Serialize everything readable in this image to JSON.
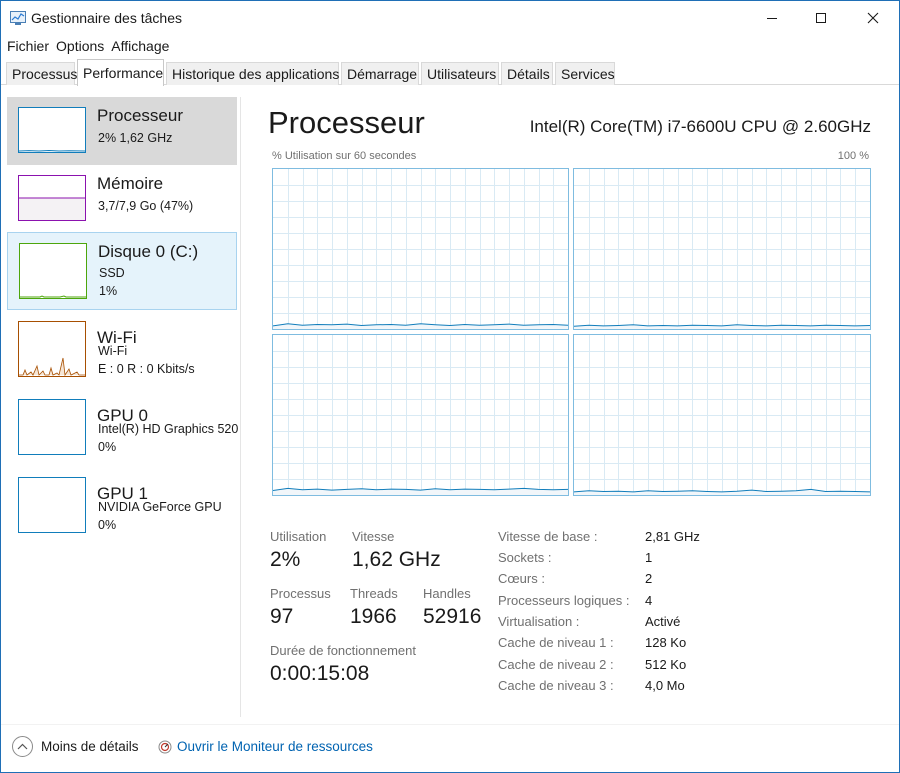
{
  "window": {
    "title": "Gestionnaire des tâches",
    "accent": "#1f6fb6"
  },
  "menu": [
    "Fichier",
    "Options",
    "Affichage"
  ],
  "tabs": [
    {
      "label": "Processus"
    },
    {
      "label": "Performance",
      "active": true
    },
    {
      "label": "Historique des applications"
    },
    {
      "label": "Démarrage"
    },
    {
      "label": "Utilisateurs"
    },
    {
      "label": "Détails"
    },
    {
      "label": "Services"
    }
  ],
  "sidebar": {
    "items": [
      {
        "title": "Processeur",
        "line1": "2%  1,62 GHz",
        "line2": "",
        "color": "#117dbb",
        "state": "selected"
      },
      {
        "title": "Mémoire",
        "line1": "3,7/7,9 Go (47%)",
        "line2": "",
        "color": "#8b12ae",
        "fill": 0.47
      },
      {
        "title": "Disque 0 (C:)",
        "line1": "SSD",
        "line2": "1%",
        "color": "#4da60c",
        "state": "hover"
      },
      {
        "title": "Wi-Fi",
        "line1": "Wi-Fi",
        "line2": "E : 0  R : 0 Kbits/s",
        "color": "#a74f01"
      },
      {
        "title": "GPU 0",
        "line1": "Intel(R) HD Graphics 520",
        "line2": "0%",
        "color": "#117dbb"
      },
      {
        "title": "GPU 1",
        "line1": "NVIDIA GeForce GPU",
        "line2": "0%",
        "color": "#117dbb"
      }
    ]
  },
  "main": {
    "title": "Processeur",
    "cpu_name": "Intel(R) Core(TM) i7-6600U CPU @ 2.60GHz",
    "chart_caption": "% Utilisation sur 60 secondes",
    "chart_max": "100 %",
    "graph_color": "#117dbb",
    "graph_count": 4
  },
  "stats": {
    "utilisation_label": "Utilisation",
    "utilisation_value": "2%",
    "vitesse_label": "Vitesse",
    "vitesse_value": "1,62 GHz",
    "processus_label": "Processus",
    "processus_value": "97",
    "threads_label": "Threads",
    "threads_value": "1966",
    "handles_label": "Handles",
    "handles_value": "52916",
    "uptime_label": "Durée de fonctionnement",
    "uptime_value": "0:00:15:08"
  },
  "specs": [
    {
      "label": "Vitesse de base :",
      "value": "2,81 GHz"
    },
    {
      "label": "Sockets :",
      "value": "1"
    },
    {
      "label": "Cœurs :",
      "value": "2"
    },
    {
      "label": "Processeurs logiques :",
      "value": "4"
    },
    {
      "label": "Virtualisation :",
      "value": "Activé"
    },
    {
      "label": "Cache de niveau 1 :",
      "value": "128 Ko"
    },
    {
      "label": "Cache de niveau 2 :",
      "value": "512 Ko"
    },
    {
      "label": "Cache de niveau 3 :",
      "value": "4,0 Mo"
    }
  ],
  "footer": {
    "less_details": "Moins de détails",
    "resource_monitor": "Ouvrir le Moniteur de ressources"
  }
}
